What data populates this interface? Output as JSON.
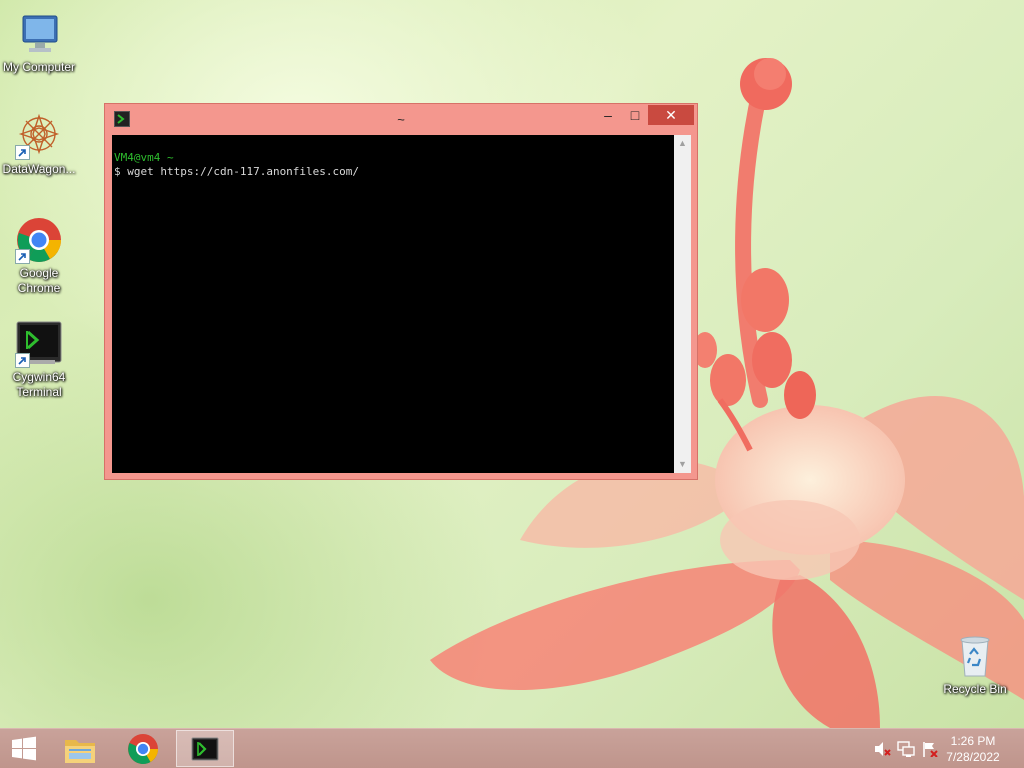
{
  "desktop": {
    "icons": [
      {
        "label": "My Computer",
        "icon": "computer-icon"
      },
      {
        "label": "DataWagon...",
        "icon": "datawagon-icon"
      },
      {
        "label": "Google Chrome",
        "icon": "chrome-icon"
      },
      {
        "label": "Cygwin64 Terminal",
        "icon": "cygwin-terminal-icon"
      },
      {
        "label": "Recycle Bin",
        "icon": "recycle-bin-icon"
      }
    ]
  },
  "window": {
    "title": "~",
    "controls": {
      "minimize": "–",
      "maximize": "□",
      "close": "✕"
    },
    "terminal": {
      "prompt_line": "VM4@vm4 ~",
      "command_line": "$ wget https://cdn-117.anonfiles.com/"
    }
  },
  "taskbar": {
    "items": [
      "start-icon",
      "file-explorer-icon",
      "chrome-icon",
      "cygwin-terminal-icon"
    ],
    "tray": [
      "speaker-muted-icon",
      "network-icon",
      "action-center-flag-icon"
    ],
    "clock": {
      "time": "1:26 PM",
      "date": "7/28/2022"
    }
  },
  "colors": {
    "window_frame": "#f4978e",
    "close_button": "#c94a40",
    "terminal_bg": "#000000",
    "prompt_green": "#2ebd2e",
    "taskbar": "#c49b92"
  }
}
